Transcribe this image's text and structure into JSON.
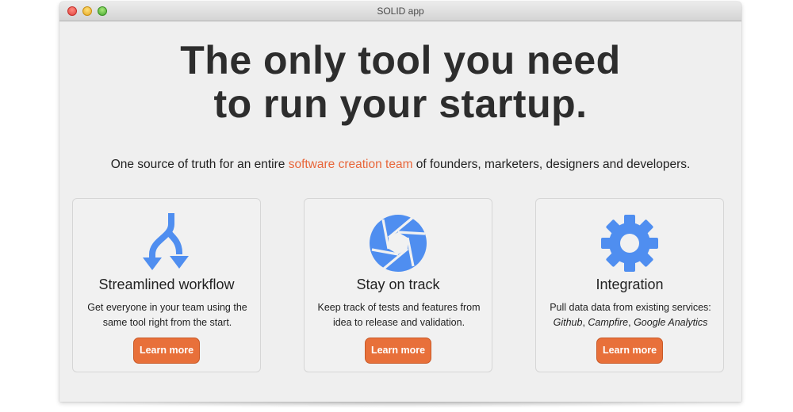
{
  "window": {
    "title": "SOLID app"
  },
  "hero": {
    "headline_line1": "The only tool you need",
    "headline_line2": "to run your startup.",
    "sub_before": "One source of truth for an entire ",
    "sub_accent": "software creation team",
    "sub_after": " of founders, marketers, designers and developers."
  },
  "colors": {
    "accent": "#e8663a",
    "icon_blue": "#4f8ef0",
    "button": "#e8703a"
  },
  "features": [
    {
      "icon": "workflow-arrows-icon",
      "title": "Streamlined workflow",
      "desc_line1": "Get everyone in your team using the",
      "desc_line2": "same tool right from the start.",
      "button": "Learn more"
    },
    {
      "icon": "aperture-icon",
      "title": "Stay on track",
      "desc_line1": "Keep track of tests and features from",
      "desc_line2": "idea to release and validation.",
      "button": "Learn more"
    },
    {
      "icon": "gear-icon",
      "title": "Integration",
      "desc_line1": "Pull data data from existing services:",
      "svc1": "Github",
      "sep1": ", ",
      "svc2": "Campfire",
      "sep2": ", ",
      "svc3": "Google Analytics",
      "button": "Learn more"
    }
  ]
}
